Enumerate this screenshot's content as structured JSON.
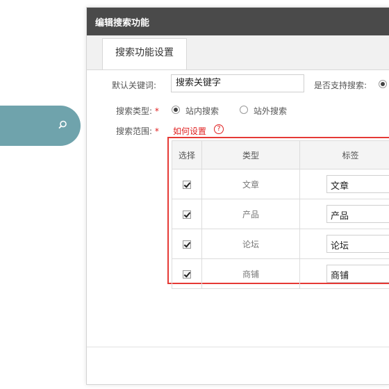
{
  "dialog": {
    "title": "编辑搜索功能"
  },
  "tabs": [
    {
      "label": "搜索功能设置",
      "active": true
    }
  ],
  "form": {
    "default_keyword_label": "默认关键词:",
    "default_keyword_value": "搜索关键字",
    "support_search_label": "是否支持搜索:",
    "support_search_selected": true,
    "search_type_label": "搜索类型:",
    "search_type_required_mark": "*",
    "search_type_options": [
      {
        "label": "站内搜索",
        "selected": true
      },
      {
        "label": "站外搜索",
        "selected": false
      }
    ],
    "scope_label": "搜索范围:",
    "scope_required_mark": "*",
    "scope_help_link": "如何设置",
    "scope_help_icon": "?"
  },
  "scope_table": {
    "columns": [
      "选择",
      "类型",
      "标签"
    ],
    "rows": [
      {
        "checked": true,
        "type": "文章",
        "tag": "文章"
      },
      {
        "checked": true,
        "type": "产品",
        "tag": "产品"
      },
      {
        "checked": true,
        "type": "论坛",
        "tag": "论坛"
      },
      {
        "checked": true,
        "type": "商铺",
        "tag": "商铺"
      }
    ]
  },
  "colors": {
    "header_bg": "#4a4a4a",
    "accent_teal": "#6fa3ac",
    "required_red": "#e02020",
    "highlight_border": "#e53935"
  },
  "icons": {
    "search_pill_icon": "search-icon"
  }
}
